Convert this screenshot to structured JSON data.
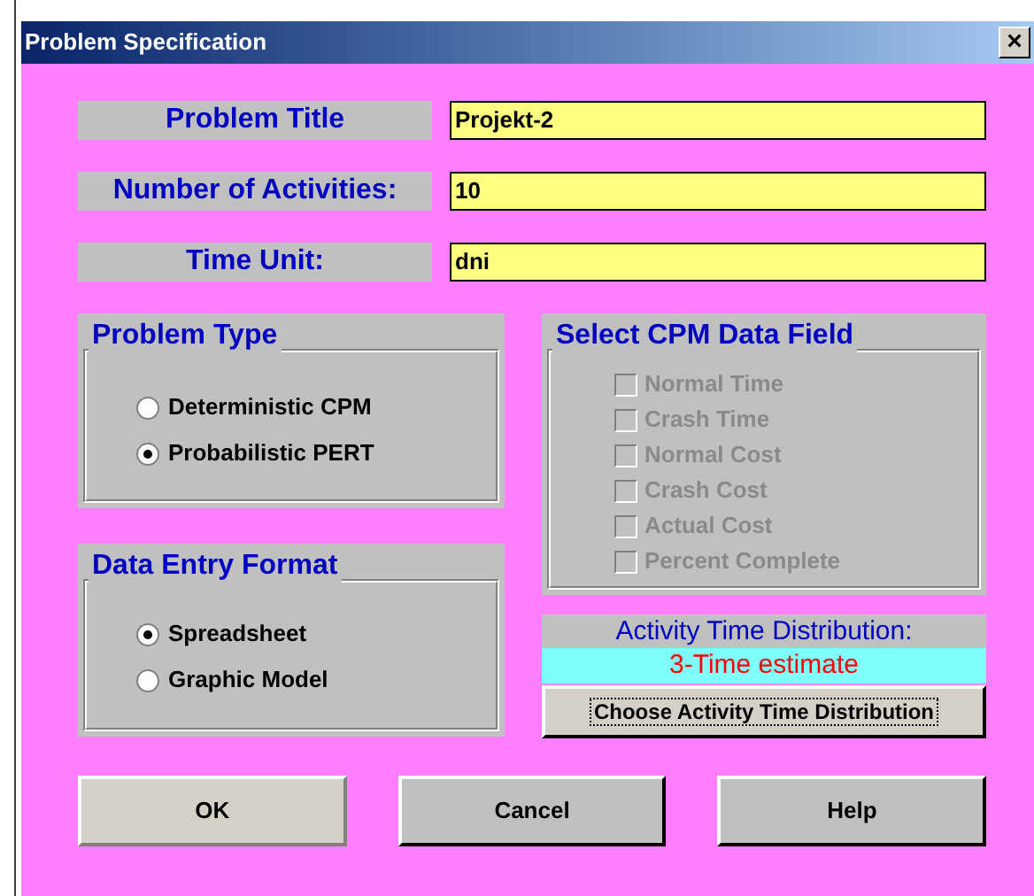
{
  "window": {
    "title": "Problem Specification",
    "close": "×"
  },
  "fields": [
    {
      "label": "Problem Title",
      "value": "Projekt-2"
    },
    {
      "label": "Number of Activities:",
      "value": "10"
    },
    {
      "label": "Time Unit:",
      "value": "dni"
    }
  ],
  "problem_type": {
    "title": "Problem Type",
    "options": [
      {
        "label": "Deterministic CPM",
        "selected": false
      },
      {
        "label": "Probabilistic PERT",
        "selected": true
      }
    ]
  },
  "data_entry_format": {
    "title": "Data Entry Format",
    "options": [
      {
        "label": "Spreadsheet",
        "selected": true
      },
      {
        "label": "Graphic Model",
        "selected": false
      }
    ]
  },
  "cpm_data_field": {
    "title": "Select CPM Data Field",
    "items": [
      {
        "label": "Normal Time",
        "checked": false,
        "disabled": true
      },
      {
        "label": "Crash Time",
        "checked": false,
        "disabled": true
      },
      {
        "label": "Normal Cost",
        "checked": false,
        "disabled": true
      },
      {
        "label": "Crash Cost",
        "checked": false,
        "disabled": true
      },
      {
        "label": "Actual Cost",
        "checked": false,
        "disabled": true
      },
      {
        "label": "Percent Complete",
        "checked": false,
        "disabled": true
      }
    ]
  },
  "time_distribution": {
    "label": "Activity Time Distribution:",
    "value": "3-Time estimate",
    "button": "Choose Activity Time Distribution"
  },
  "buttons": [
    {
      "label": "OK",
      "selected": true
    },
    {
      "label": "Cancel",
      "selected": false
    },
    {
      "label": "Help",
      "selected": false
    }
  ]
}
